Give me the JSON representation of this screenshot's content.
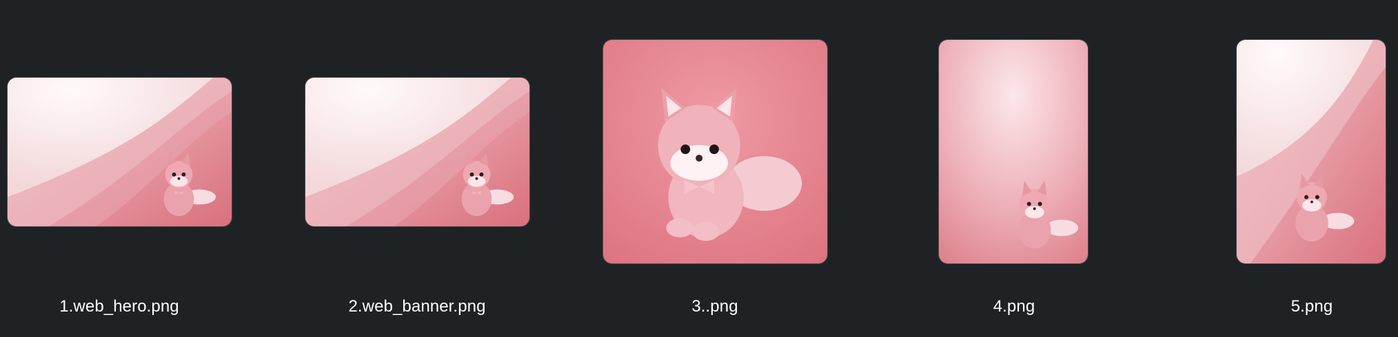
{
  "files": [
    {
      "name": "1.web_hero.png",
      "variant": "wave"
    },
    {
      "name": "2.web_banner.png",
      "variant": "wave"
    },
    {
      "name": "3..png",
      "variant": "closeup"
    },
    {
      "name": "4.png",
      "variant": "plain"
    },
    {
      "name": "5.png",
      "variant": "wave"
    }
  ],
  "colors": {
    "background": "#1f2224",
    "pink": "#e08a95",
    "pink_dark": "#c9606e",
    "cream": "#fbecea"
  },
  "icons": {
    "subject": "pink-fox-plush-icon"
  }
}
